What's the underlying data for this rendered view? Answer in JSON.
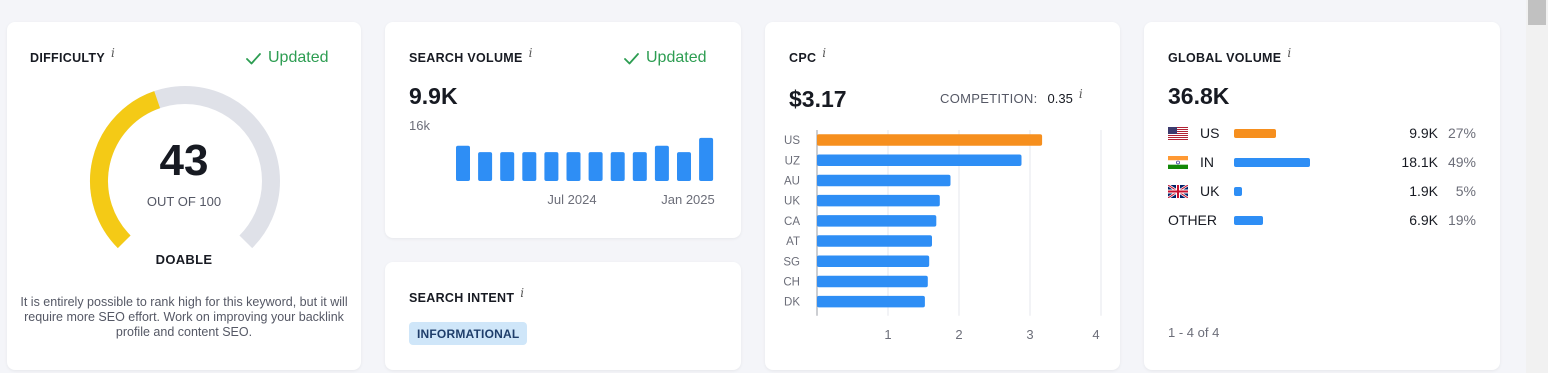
{
  "difficulty": {
    "label": "DIFFICULTY",
    "info": "i",
    "updated": "Updated",
    "score": "43",
    "score_value": 43,
    "out_of": "OUT OF 100",
    "rating": "DOABLE",
    "description": "It is entirely possible to rank high for this keyword, but it will require more SEO effort. Work on improving your backlink profile and content SEO.",
    "colors": {
      "fill": "#f4ca16",
      "track": "#dfe1e8"
    }
  },
  "search_volume": {
    "label": "SEARCH VOLUME",
    "info": "i",
    "updated": "Updated",
    "value": "9.9K",
    "y_tick": "16k",
    "x_ticks": [
      "Jul 2024",
      "Jan 2025"
    ],
    "bar_color": "#2e8ef5"
  },
  "search_intent": {
    "label": "SEARCH INTENT",
    "info": "i",
    "badge": "INFORMATIONAL",
    "badge_colors": {
      "bg": "#cfe6f9",
      "fg": "#1f3e6b"
    }
  },
  "cpc": {
    "label": "CPC",
    "info": "i",
    "value": "$3.17",
    "competition_label": "COMPETITION:",
    "competition_value": "0.35",
    "competition_info": "i"
  },
  "global_volume": {
    "label": "GLOBAL VOLUME",
    "info": "i",
    "value": "36.8K",
    "rows": [
      {
        "flag": "us-flag-icon",
        "country": "US",
        "volume": "9.9K",
        "share": "27%",
        "share_value": 27,
        "color": "#f68f1e"
      },
      {
        "flag": "in-flag-icon",
        "country": "IN",
        "volume": "18.1K",
        "share": "49%",
        "share_value": 49,
        "color": "#2e8ef5"
      },
      {
        "flag": "uk-flag-icon",
        "country": "UK",
        "volume": "1.9K",
        "share": "5%",
        "share_value": 5,
        "color": "#2e8ef5"
      },
      {
        "flag": "",
        "country": "OTHER",
        "volume": "6.9K",
        "share": "19%",
        "share_value": 19,
        "color": "#2e8ef5"
      }
    ],
    "pagination": "1 - 4 of 4"
  },
  "chart_data": [
    {
      "type": "bar",
      "title": "",
      "xlabel": "",
      "ylabel": "",
      "ylim": [
        0,
        16000
      ],
      "y_tick_labels": [
        "16k"
      ],
      "x_tick_labels": [
        "Jul 2024",
        "Jan 2025"
      ],
      "categories": [
        "m1",
        "m2",
        "m3",
        "m4",
        "m5",
        "m6",
        "m7",
        "m8",
        "m9",
        "m10",
        "m11",
        "m12"
      ],
      "values": [
        9900,
        8100,
        8100,
        8100,
        8100,
        8100,
        8100,
        8100,
        8100,
        9900,
        8100,
        12100
      ],
      "grid": false
    },
    {
      "type": "bar",
      "orientation": "horizontal",
      "title": "",
      "xlabel": "",
      "ylabel": "",
      "categories": [
        "US",
        "UZ",
        "AU",
        "UK",
        "CA",
        "AT",
        "SG",
        "CH",
        "DK"
      ],
      "values": [
        3.17,
        2.88,
        1.88,
        1.73,
        1.68,
        1.62,
        1.58,
        1.56,
        1.52
      ],
      "highlight": "US",
      "highlight_color": "#f68f1e",
      "bar_color": "#2e8ef5",
      "xlim": [
        0,
        4
      ],
      "x_tick_labels": [
        "1",
        "2",
        "3",
        "4"
      ],
      "grid": true
    }
  ]
}
